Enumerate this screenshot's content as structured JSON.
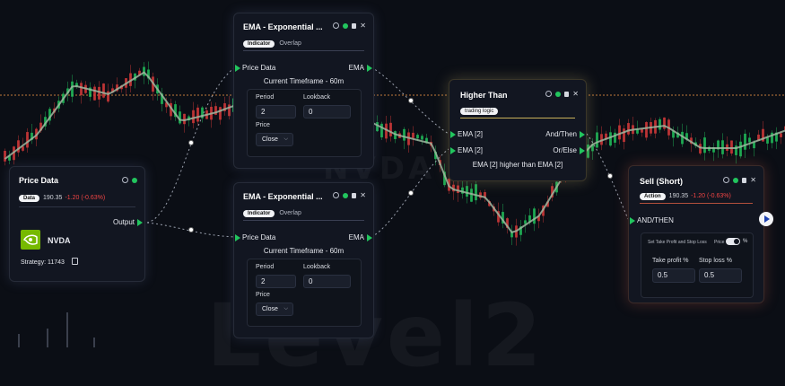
{
  "watermark": {
    "left_text": "NVDA",
    "bottom_text": "Level2"
  },
  "colors": {
    "accent_green": "#22c55e",
    "negative_red": "#ef4444",
    "gold_line": "#c8b05a",
    "red_line": "#b4503c"
  },
  "nodes": {
    "price_data": {
      "title": "Price Data",
      "tag": "Data",
      "price": "190.35",
      "change": "-1.20 (-0.63%)",
      "output_label": "Output",
      "ticker": "NVDA",
      "strategy": "Strategy: 11743",
      "icon": "nvidia-logo-icon"
    },
    "ema_top": {
      "title": "EMA - Exponential ...",
      "tag": "Indicator",
      "tag_alt": "Overlap",
      "input_label": "Price Data",
      "output_label": "EMA",
      "timeframe": "Current Timeframe - 60m",
      "period_label": "Period",
      "period_value": "2",
      "lookback_label": "Lookback",
      "lookback_value": "0",
      "price_label": "Price",
      "price_value": "Close"
    },
    "ema_bottom": {
      "title": "EMA - Exponential ...",
      "tag": "Indicator",
      "tag_alt": "Overlap",
      "input_label": "Price Data",
      "output_label": "EMA",
      "timeframe": "Current Timeframe - 60m",
      "period_label": "Period",
      "period_value": "2",
      "lookback_label": "Lookback",
      "lookback_value": "0",
      "price_label": "Price",
      "price_value": "Close"
    },
    "higher_than": {
      "title": "Higher Than",
      "tag": "trading logic",
      "input_a": "EMA [2]",
      "input_b": "EMA [2]",
      "output_and": "And/Then",
      "output_or": "Or/Else",
      "summary": "EMA [2] higher than EMA [2]"
    },
    "sell_short": {
      "title": "Sell (Short)",
      "tag": "Action",
      "price": "190.35",
      "change": "-1.20 (-0.63%)",
      "input_label": "AND/THEN",
      "tp_sl_label": "Set Take Profit and Stop Loss",
      "toggle_left": "Price",
      "toggle_right": "%",
      "take_profit_label": "Take profit %",
      "take_profit_value": "0.5",
      "stop_loss_label": "Stop loss %",
      "stop_loss_value": "0.5"
    }
  }
}
